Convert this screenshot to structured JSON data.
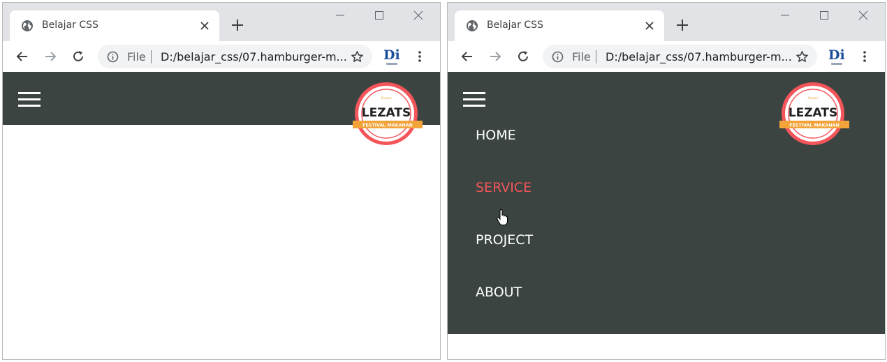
{
  "windows": [
    {
      "id": "left",
      "tab": {
        "title": "Belajar CSS"
      },
      "omnibox": {
        "scheme": "File",
        "url": "D:/belajar_css/07.hamburger-m..."
      },
      "extension": {
        "letters": "Di"
      },
      "page": {
        "logo": {
          "top": "Suzan",
          "name": "LEZATS",
          "ribbon": "FESTIVAL MAKANAN"
        },
        "menu_open": false
      }
    },
    {
      "id": "right",
      "tab": {
        "title": "Belajar CSS"
      },
      "omnibox": {
        "scheme": "File",
        "url": "D:/belajar_css/07.hamburger-m..."
      },
      "extension": {
        "letters": "Di"
      },
      "page": {
        "logo": {
          "top": "Suzan",
          "name": "LEZATS",
          "ribbon": "FESTIVAL MAKANAN"
        },
        "menu_open": true,
        "menu": [
          "HOME",
          "SERVICE",
          "PROJECT",
          "ABOUT"
        ],
        "active_item": "SERVICE"
      }
    }
  ],
  "colors": {
    "navbar": "#3b4441",
    "menu_text": "#ffffff",
    "menu_hover": "#f4555a",
    "badge_red": "#f4555a",
    "ribbon_orange": "#f2a33a"
  },
  "icons": [
    "globe-icon",
    "close-icon",
    "plus-icon",
    "minimize-icon",
    "maximize-icon",
    "back-arrow-icon",
    "forward-arrow-icon",
    "reload-icon",
    "info-icon",
    "star-icon",
    "kebab-menu-icon",
    "hamburger-icon",
    "hand-pointer-icon"
  ]
}
